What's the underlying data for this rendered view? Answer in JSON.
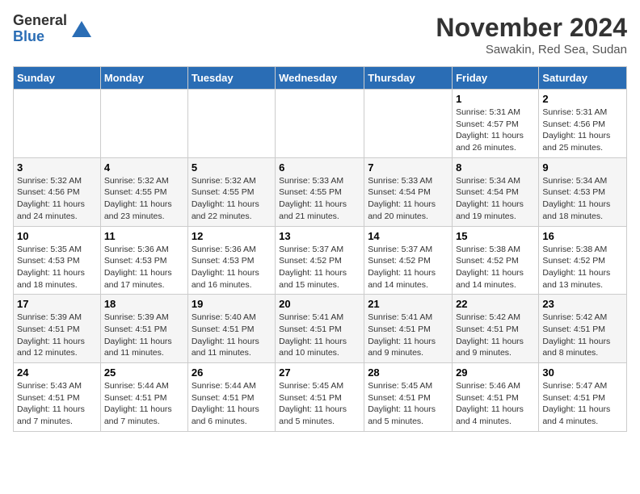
{
  "logo": {
    "general": "General",
    "blue": "Blue"
  },
  "title": "November 2024",
  "location": "Sawakin, Red Sea, Sudan",
  "days_of_week": [
    "Sunday",
    "Monday",
    "Tuesday",
    "Wednesday",
    "Thursday",
    "Friday",
    "Saturday"
  ],
  "weeks": [
    [
      {
        "day": "",
        "info": ""
      },
      {
        "day": "",
        "info": ""
      },
      {
        "day": "",
        "info": ""
      },
      {
        "day": "",
        "info": ""
      },
      {
        "day": "",
        "info": ""
      },
      {
        "day": "1",
        "info": "Sunrise: 5:31 AM\nSunset: 4:57 PM\nDaylight: 11 hours and 26 minutes."
      },
      {
        "day": "2",
        "info": "Sunrise: 5:31 AM\nSunset: 4:56 PM\nDaylight: 11 hours and 25 minutes."
      }
    ],
    [
      {
        "day": "3",
        "info": "Sunrise: 5:32 AM\nSunset: 4:56 PM\nDaylight: 11 hours and 24 minutes."
      },
      {
        "day": "4",
        "info": "Sunrise: 5:32 AM\nSunset: 4:55 PM\nDaylight: 11 hours and 23 minutes."
      },
      {
        "day": "5",
        "info": "Sunrise: 5:32 AM\nSunset: 4:55 PM\nDaylight: 11 hours and 22 minutes."
      },
      {
        "day": "6",
        "info": "Sunrise: 5:33 AM\nSunset: 4:55 PM\nDaylight: 11 hours and 21 minutes."
      },
      {
        "day": "7",
        "info": "Sunrise: 5:33 AM\nSunset: 4:54 PM\nDaylight: 11 hours and 20 minutes."
      },
      {
        "day": "8",
        "info": "Sunrise: 5:34 AM\nSunset: 4:54 PM\nDaylight: 11 hours and 19 minutes."
      },
      {
        "day": "9",
        "info": "Sunrise: 5:34 AM\nSunset: 4:53 PM\nDaylight: 11 hours and 18 minutes."
      }
    ],
    [
      {
        "day": "10",
        "info": "Sunrise: 5:35 AM\nSunset: 4:53 PM\nDaylight: 11 hours and 18 minutes."
      },
      {
        "day": "11",
        "info": "Sunrise: 5:36 AM\nSunset: 4:53 PM\nDaylight: 11 hours and 17 minutes."
      },
      {
        "day": "12",
        "info": "Sunrise: 5:36 AM\nSunset: 4:53 PM\nDaylight: 11 hours and 16 minutes."
      },
      {
        "day": "13",
        "info": "Sunrise: 5:37 AM\nSunset: 4:52 PM\nDaylight: 11 hours and 15 minutes."
      },
      {
        "day": "14",
        "info": "Sunrise: 5:37 AM\nSunset: 4:52 PM\nDaylight: 11 hours and 14 minutes."
      },
      {
        "day": "15",
        "info": "Sunrise: 5:38 AM\nSunset: 4:52 PM\nDaylight: 11 hours and 14 minutes."
      },
      {
        "day": "16",
        "info": "Sunrise: 5:38 AM\nSunset: 4:52 PM\nDaylight: 11 hours and 13 minutes."
      }
    ],
    [
      {
        "day": "17",
        "info": "Sunrise: 5:39 AM\nSunset: 4:51 PM\nDaylight: 11 hours and 12 minutes."
      },
      {
        "day": "18",
        "info": "Sunrise: 5:39 AM\nSunset: 4:51 PM\nDaylight: 11 hours and 11 minutes."
      },
      {
        "day": "19",
        "info": "Sunrise: 5:40 AM\nSunset: 4:51 PM\nDaylight: 11 hours and 11 minutes."
      },
      {
        "day": "20",
        "info": "Sunrise: 5:41 AM\nSunset: 4:51 PM\nDaylight: 11 hours and 10 minutes."
      },
      {
        "day": "21",
        "info": "Sunrise: 5:41 AM\nSunset: 4:51 PM\nDaylight: 11 hours and 9 minutes."
      },
      {
        "day": "22",
        "info": "Sunrise: 5:42 AM\nSunset: 4:51 PM\nDaylight: 11 hours and 9 minutes."
      },
      {
        "day": "23",
        "info": "Sunrise: 5:42 AM\nSunset: 4:51 PM\nDaylight: 11 hours and 8 minutes."
      }
    ],
    [
      {
        "day": "24",
        "info": "Sunrise: 5:43 AM\nSunset: 4:51 PM\nDaylight: 11 hours and 7 minutes."
      },
      {
        "day": "25",
        "info": "Sunrise: 5:44 AM\nSunset: 4:51 PM\nDaylight: 11 hours and 7 minutes."
      },
      {
        "day": "26",
        "info": "Sunrise: 5:44 AM\nSunset: 4:51 PM\nDaylight: 11 hours and 6 minutes."
      },
      {
        "day": "27",
        "info": "Sunrise: 5:45 AM\nSunset: 4:51 PM\nDaylight: 11 hours and 5 minutes."
      },
      {
        "day": "28",
        "info": "Sunrise: 5:45 AM\nSunset: 4:51 PM\nDaylight: 11 hours and 5 minutes."
      },
      {
        "day": "29",
        "info": "Sunrise: 5:46 AM\nSunset: 4:51 PM\nDaylight: 11 hours and 4 minutes."
      },
      {
        "day": "30",
        "info": "Sunrise: 5:47 AM\nSunset: 4:51 PM\nDaylight: 11 hours and 4 minutes."
      }
    ]
  ]
}
